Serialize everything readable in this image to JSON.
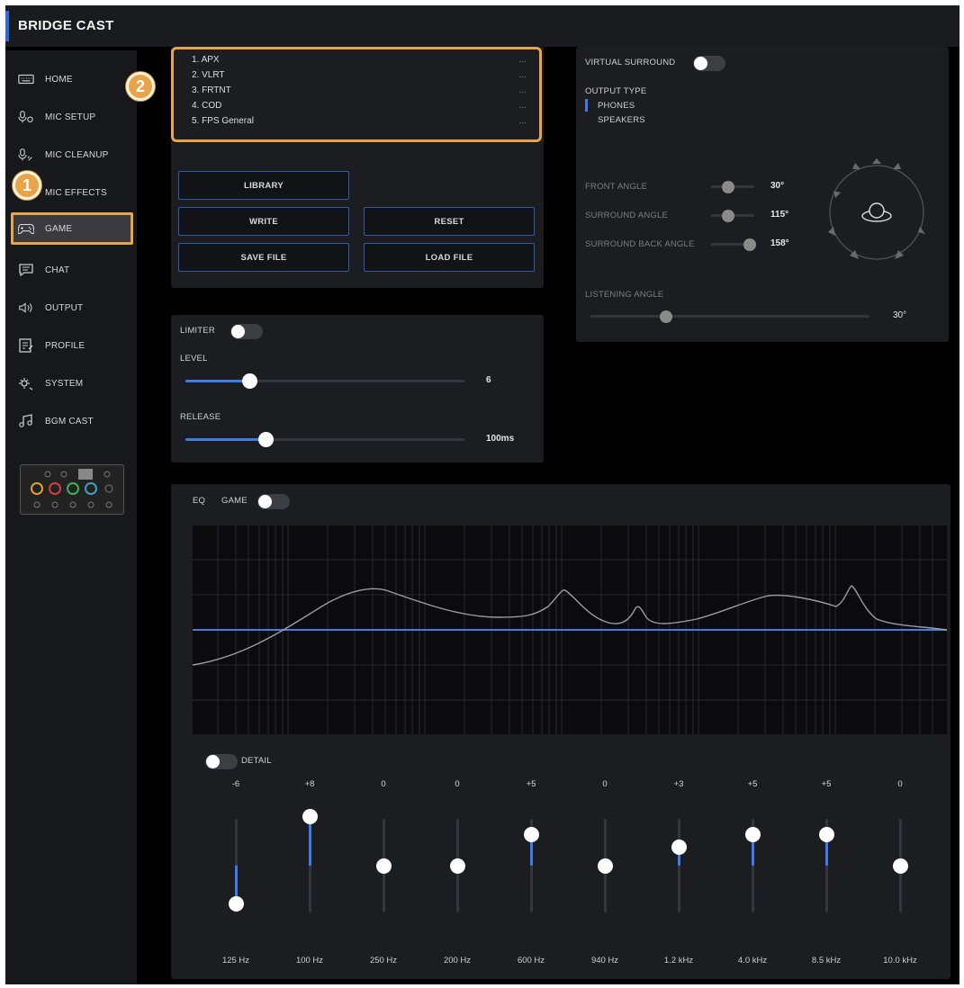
{
  "app": {
    "title": "BRIDGE CAST"
  },
  "sidebar": {
    "items": [
      {
        "label": "HOME",
        "icon": "keyboard-icon"
      },
      {
        "label": "MIC SETUP",
        "icon": "mic-setup-icon"
      },
      {
        "label": "MIC CLEANUP",
        "icon": "mic-cleanup-icon"
      },
      {
        "label": "MIC EFFECTS",
        "icon": "mic-effects-icon"
      },
      {
        "label": "GAME",
        "icon": "gamepad-icon",
        "active": true
      },
      {
        "label": "CHAT",
        "icon": "chat-icon"
      },
      {
        "label": "OUTPUT",
        "icon": "speaker-icon"
      },
      {
        "label": "PROFILE",
        "icon": "profile-icon"
      },
      {
        "label": "SYSTEM",
        "icon": "system-icon"
      },
      {
        "label": "BGM CAST",
        "icon": "music-icon"
      }
    ]
  },
  "callouts": {
    "one": "1",
    "two": "2"
  },
  "library": {
    "items": [
      {
        "name": "1. APX",
        "more": "..."
      },
      {
        "name": "2. VLRT",
        "more": "..."
      },
      {
        "name": "3. FRTNT",
        "more": "..."
      },
      {
        "name": "4. COD",
        "more": "..."
      },
      {
        "name": "5. FPS General",
        "more": "..."
      }
    ],
    "buttons": {
      "library": "LIBRARY",
      "write": "WRITE",
      "reset": "RESET",
      "save_file": "SAVE FILE",
      "load_file": "LOAD FILE"
    }
  },
  "limiter": {
    "label": "LIMITER",
    "enabled": false,
    "level": {
      "label": "LEVEL",
      "value": "6",
      "fraction": 0.23
    },
    "release": {
      "label": "RELEASE",
      "value": "100ms",
      "fraction": 0.29
    }
  },
  "surround": {
    "label": "VIRTUAL SURROUND",
    "enabled": false,
    "output_type": {
      "label": "OUTPUT TYPE",
      "options": [
        "PHONES",
        "SPEAKERS"
      ],
      "selected": "PHONES"
    },
    "front_angle": {
      "label": "FRONT ANGLE",
      "value": "30°",
      "fraction": 0.4
    },
    "surround_angle": {
      "label": "SURROUND ANGLE",
      "value": "115°",
      "fraction": 0.4
    },
    "surround_back_angle": {
      "label": "SURROUND BACK ANGLE",
      "value": "158°",
      "fraction": 0.9
    },
    "listening_angle": {
      "label": "LISTENING ANGLE",
      "value": "30°",
      "fraction": 0.27
    }
  },
  "eq": {
    "label": "EQ",
    "mode": "GAME",
    "enabled": false,
    "detail": {
      "label": "DETAIL",
      "enabled": false
    },
    "gain_range": [
      -12,
      12
    ],
    "bands": [
      {
        "gain_label": "-6",
        "gain": -6,
        "freq": "125 Hz"
      },
      {
        "gain_label": "+8",
        "gain": 8,
        "freq": "100 Hz"
      },
      {
        "gain_label": "0",
        "gain": 0,
        "freq": "250 Hz"
      },
      {
        "gain_label": "0",
        "gain": 0,
        "freq": "200 Hz"
      },
      {
        "gain_label": "+5",
        "gain": 5,
        "freq": "600 Hz"
      },
      {
        "gain_label": "0",
        "gain": 0,
        "freq": "940 Hz"
      },
      {
        "gain_label": "+3",
        "gain": 3,
        "freq": "1.2 kHz"
      },
      {
        "gain_label": "+5",
        "gain": 5,
        "freq": "4.0 kHz"
      },
      {
        "gain_label": "+5",
        "gain": 5,
        "freq": "8.5 kHz"
      },
      {
        "gain_label": "0",
        "gain": 0,
        "freq": "10.0 kHz"
      }
    ]
  },
  "colors": {
    "accent": "#3f7bea",
    "callout": "#e7a44a",
    "panel": "#1c1d21"
  }
}
